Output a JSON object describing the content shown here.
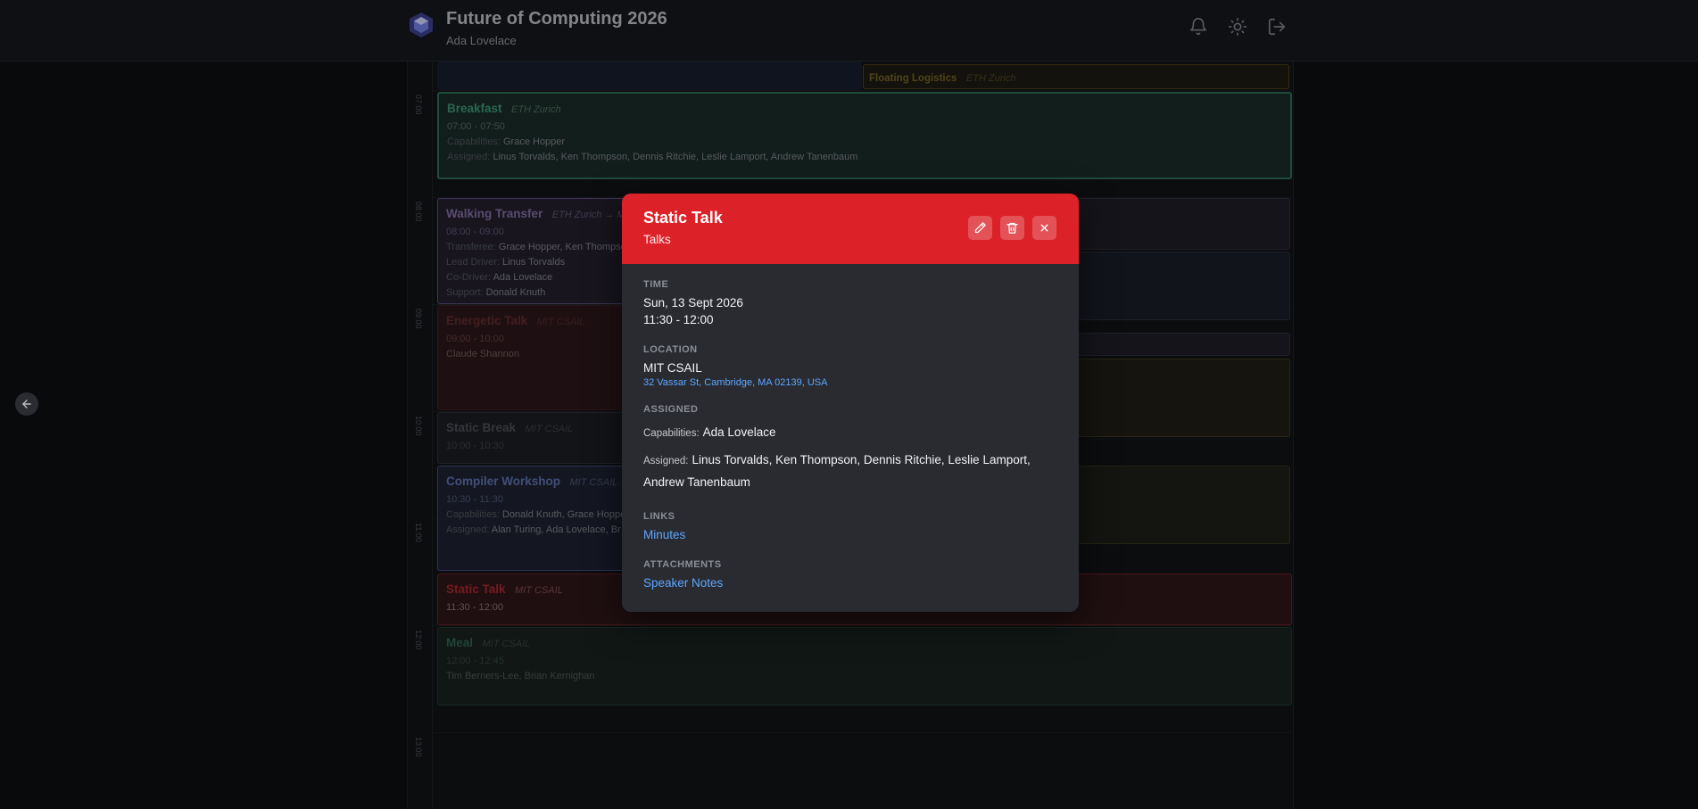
{
  "header": {
    "title": "Future of Computing 2026",
    "user": "Ada Lovelace",
    "icons": [
      "bell-icon",
      "sun-icon",
      "logout-icon"
    ]
  },
  "calendar": {
    "hours": [
      "07:00",
      "08:00",
      "09:00",
      "10:00",
      "11:00",
      "12:00",
      "13:00"
    ],
    "events": {
      "floating": {
        "title": "Floating Logistics",
        "location": "ETH Zurich"
      },
      "breakfast": {
        "title": "Breakfast",
        "location": "ETH Zurich",
        "time": "07:00 - 07:50",
        "capabilities_label": "Capabilities:",
        "capabilities": "Grace Hopper",
        "assigned_label": "Assigned:",
        "assigned": "Linus Torvalds, Ken Thompson, Dennis Ritchie, Leslie Lamport, Andrew Tanenbaum"
      },
      "walking": {
        "title": "Walking Transfer",
        "location": "ETH Zurich → MIT",
        "time": "08:00 - 09:00",
        "transferee_label": "Transferee:",
        "transferee": "Grace Hopper, Ken Thompson",
        "lead_label": "Lead Driver:",
        "lead": "Linus Torvalds",
        "codriver_label": "Co-Driver:",
        "codriver": "Ada Lovelace",
        "support_label": "Support:",
        "support": "Donald Knuth"
      },
      "energetic": {
        "title": "Energetic Talk",
        "location": "MIT CSAIL",
        "time": "09:00 - 10:00",
        "people": "Claude Shannon"
      },
      "static_break": {
        "title": "Static Break",
        "location": "MIT CSAIL",
        "time": "10:00 - 10:30"
      },
      "compiler": {
        "title": "Compiler Workshop",
        "location": "MIT CSAIL",
        "time": "10:30 - 11:30",
        "capabilities_label": "Capabilities:",
        "capabilities": "Donald Knuth, Grace Hopper",
        "assigned_label": "Assigned:",
        "assigned": "Alan Turing, Ada Lovelace, Br"
      },
      "static_talk": {
        "title": "Static Talk",
        "location": "MIT CSAIL",
        "time": "11:30 - 12:00"
      },
      "meal": {
        "title": "Meal",
        "location": "MIT CSAIL",
        "time": "12:00 - 12:45",
        "people": "Tim Berners-Lee, Brian Kernighan"
      }
    },
    "colors": {
      "breakfast": "#3b8f6f",
      "walking": "#8b6fb0",
      "energetic": "#b02a30",
      "compiler": "#5b72b8",
      "static_talk": "#dc2228",
      "meal": "#2f6f55",
      "floating": "#8a7a2a"
    }
  },
  "modal": {
    "title": "Static Talk",
    "category": "Talks",
    "time_label": "TIME",
    "date": "Sun, 13 Sept 2026",
    "time": "11:30 - 12:00",
    "location_label": "LOCATION",
    "location_name": "MIT CSAIL",
    "address": "32 Vassar St, Cambridge, MA 02139, USA",
    "assigned_label": "ASSIGNED",
    "capabilities_key": "Capabilities:",
    "capabilities_value": "Ada Lovelace",
    "assigned_key": "Assigned:",
    "assigned_value": "Linus Torvalds, Ken Thompson, Dennis Ritchie, Leslie Lamport, Andrew Tanenbaum",
    "links_label": "LINKS",
    "link_minutes": "Minutes",
    "attachments_label": "ATTACHMENTS",
    "attachment_notes": "Speaker Notes",
    "header_color": "#dc2228"
  }
}
